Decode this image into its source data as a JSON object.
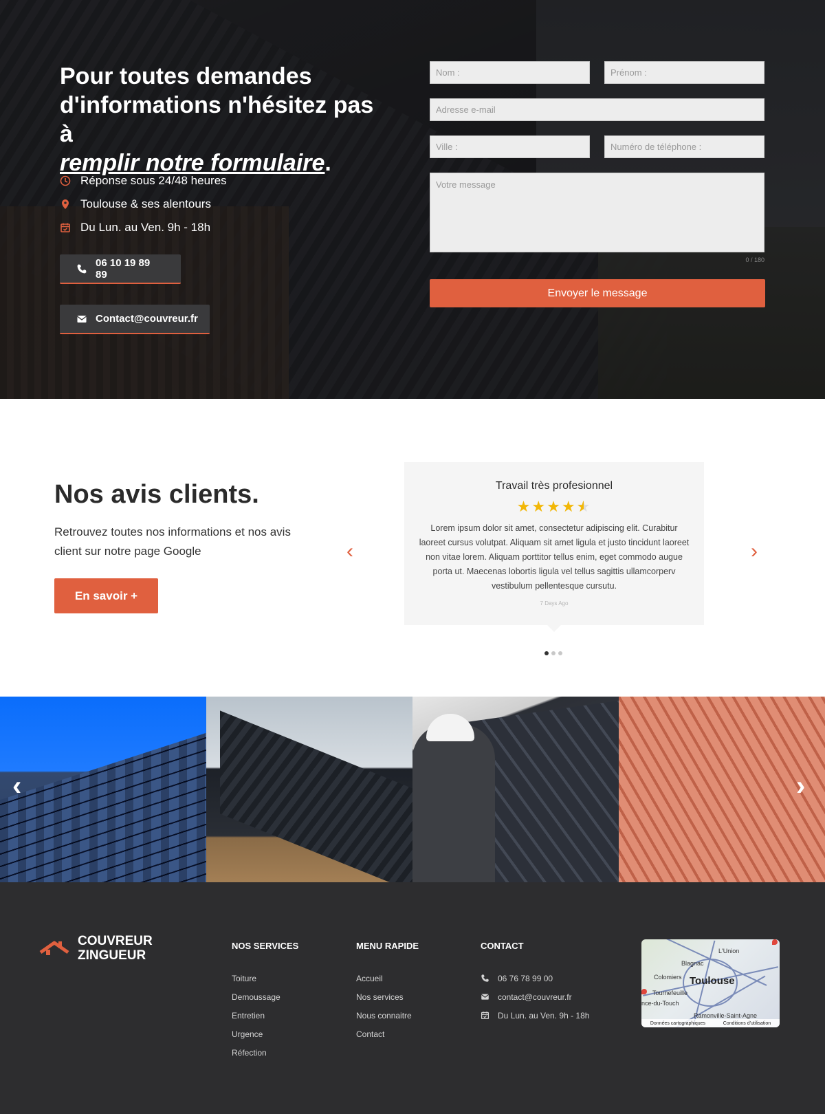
{
  "hero": {
    "heading_line1": "Pour toutes demandes d'informations n'hésitez pas à",
    "heading_emphasis": "remplir notre formulaire",
    "heading_end": ".",
    "info": [
      {
        "icon": "clock-icon",
        "text": "Réponse sous 24/48 heures"
      },
      {
        "icon": "location-pin-icon",
        "text": "Toulouse & ses alentours"
      },
      {
        "icon": "calendar-icon",
        "text": "Du Lun. au Ven. 9h - 18h"
      }
    ],
    "phone_button": "06 10 19 89 89",
    "email_button": "Contact@couvreur.fr"
  },
  "form": {
    "nom_placeholder": "Nom :",
    "prenom_placeholder": "Prénom :",
    "email_placeholder": "Adresse e-mail",
    "ville_placeholder": "Ville :",
    "phone_placeholder": "Numéro de téléphone :",
    "message_placeholder": "Votre message",
    "char_count": "0 / 180",
    "submit_label": "Envoyer le message"
  },
  "reviews": {
    "title": "Nos avis clients.",
    "subtitle": "Retrouvez toutes nos informations et nos avis client sur notre page Google",
    "button_label": "En savoir  +",
    "card": {
      "title": "Travail très profesionnel",
      "rating": 4.5,
      "text": "Lorem ipsum dolor sit amet, consectetur adipiscing elit. Curabitur laoreet cursus volutpat. Aliquam sit amet ligula et justo tincidunt laoreet non vitae lorem. Aliquam porttitor tellus enim, eget commodo augue porta ut. Maecenas lobortis ligula vel tellus sagittis ullamcorperv vestibulum pellentesque cursutu.",
      "date": "7 Days Ago"
    },
    "pagination": {
      "total": 3,
      "active": 1
    }
  },
  "gallery": {
    "images": [
      "tiled-blue-roof-photo",
      "metal-roof-house-photo",
      "roofer-workers-photo",
      "terracotta-tiles-photo"
    ]
  },
  "footer": {
    "logo_line1": "COUVREUR",
    "logo_line2": "ZINGUEUR",
    "services_title": "NOS SERVICES",
    "services": [
      "Toiture",
      "Demoussage",
      "Entretien",
      "Urgence",
      "Réfection"
    ],
    "menu_title": "MENU RAPIDE",
    "menu": [
      "Accueil",
      "Nos services",
      "Nous connaitre",
      "Contact"
    ],
    "contact_title": "CONTACT",
    "contact": [
      {
        "icon": "phone-icon",
        "text": "06 76 78 99 00"
      },
      {
        "icon": "envelope-icon",
        "text": "contact@couvreur.fr"
      },
      {
        "icon": "calendar-icon",
        "text": "Du Lun. au Ven. 9h - 18h"
      }
    ],
    "map": {
      "city": "Toulouse",
      "labels": [
        "L'Union",
        "Blagnac",
        "Colomiers",
        "Tournefeuille",
        "nce-du-Touch",
        "Ramonville-Saint-Agne"
      ],
      "footer_left": "Données cartographiques",
      "footer_right": "Conditions d'utilisation"
    }
  },
  "colors": {
    "accent": "#e0603f",
    "dark": "#2d2d2f",
    "star": "#f2b706"
  }
}
